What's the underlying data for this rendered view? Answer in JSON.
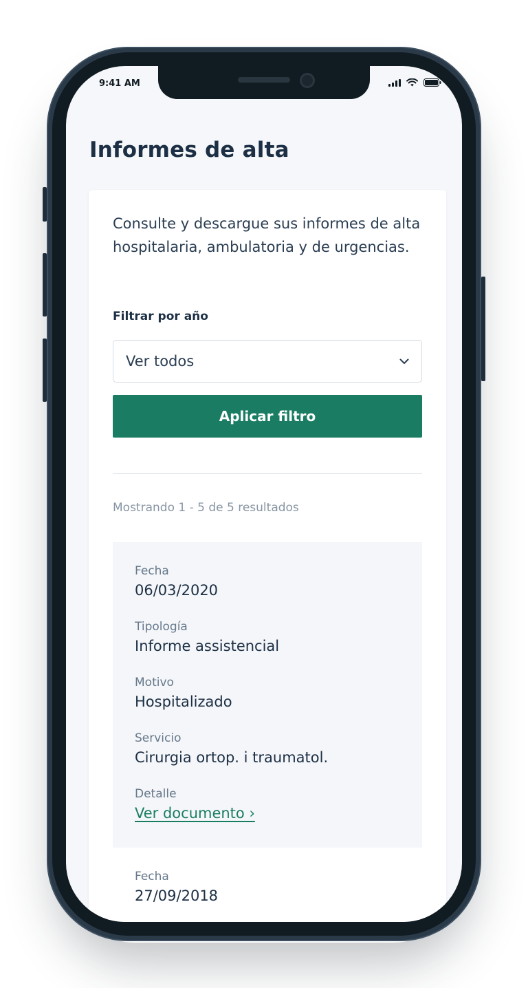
{
  "status_bar": {
    "time": "9:41 AM"
  },
  "page": {
    "title": "Informes de alta"
  },
  "card": {
    "intro": "Consulte y descargue sus informes de alta hospitalaria, ambulatoria y de urgencias.",
    "filter": {
      "label": "Filtrar por año",
      "selected": "Ver todos"
    },
    "apply_button": "Aplicar filtro",
    "results_count": "Mostrando 1 - 5 de 5 resultados"
  },
  "records": [
    {
      "date_label": "Fecha",
      "date": "06/03/2020",
      "type_label": "Tipología",
      "type": "Informe assistencial",
      "reason_label": "Motivo",
      "reason": "Hospitalizado",
      "service_label": "Servicio",
      "service": "Cirurgia ortop. i traumatol.",
      "detail_label": "Detalle",
      "detail_link": "Ver documento ›"
    },
    {
      "date_label": "Fecha",
      "date": "27/09/2018"
    }
  ],
  "colors": {
    "accent": "#1a7d63",
    "title": "#1c2f44",
    "background": "#f5f7fa"
  }
}
